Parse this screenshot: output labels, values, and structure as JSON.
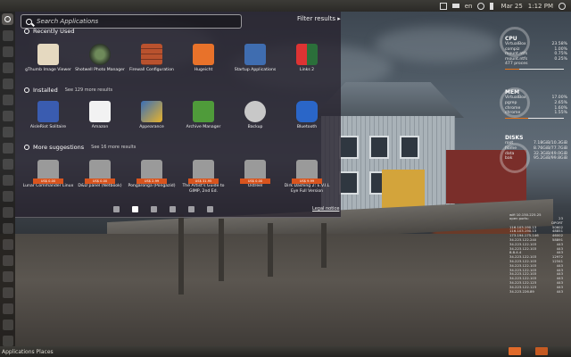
{
  "top_panel": {
    "keyboard": "en",
    "date": "Mar 25",
    "time": "1:12 PM"
  },
  "dash": {
    "search_placeholder": "Search Applications",
    "filter_label": "Filter results",
    "recent": {
      "title": "Recently Used",
      "apps": [
        {
          "label": "gThumb Image Viewer",
          "icon": "eye-icon",
          "color": "#e5d9c0"
        },
        {
          "label": "Shotwell Photo Manager",
          "icon": "camera-lens-icon",
          "color": "#3d4a3a"
        },
        {
          "label": "Firewall Configuration",
          "icon": "brick-wall-icon",
          "color": "#b9522e"
        },
        {
          "label": "Hugeicht",
          "icon": "share-icon",
          "color": "#e8722a"
        },
        {
          "label": "Startup Applications",
          "icon": "gear-icon",
          "color": "#3f6db0"
        },
        {
          "label": "Links 2",
          "icon": "links-icon",
          "color": "#2b6f3a"
        }
      ]
    },
    "installed": {
      "title": "Installed",
      "more": "See 129 more results",
      "apps": [
        {
          "label": "AisleRiot Solitaire",
          "icon": "cards-icon",
          "color": "#3a5cb0"
        },
        {
          "label": "Amazon",
          "icon": "amazon-icon",
          "color": "#f2f2f2"
        },
        {
          "label": "Appearance",
          "icon": "appearance-icon",
          "color": "#3a6fb8"
        },
        {
          "label": "Archive Manager",
          "icon": "archive-icon",
          "color": "#4f9b3a"
        },
        {
          "label": "Backup",
          "icon": "backup-icon",
          "color": "#c8c8c8"
        },
        {
          "label": "Bluetooth",
          "icon": "bluetooth-icon",
          "color": "#2a66c8"
        }
      ]
    },
    "suggestions": {
      "title": "More suggestions",
      "more": "See 16 more results",
      "apps": [
        {
          "label": "Lunar Commander Linux",
          "price": "US$ 0.00",
          "icon": "package-icon"
        },
        {
          "label": "D&D panel (Netbook)",
          "price": "US$ 0.00",
          "icon": "package-icon"
        },
        {
          "label": "Pongaronga (Pongazid)",
          "price": "US$ 2.99",
          "icon": "package-icon"
        },
        {
          "label": "The Artist's Guide to GIMP, 2nd Ed.",
          "price": "US$ 31.95",
          "icon": "package-icon"
        },
        {
          "label": "Ostreel",
          "price": "US$ 0.00",
          "icon": "package-icon"
        },
        {
          "label": "Dirk Dashing 2: E.V.I.L Eye Full Version",
          "price": "US$ 9.99",
          "icon": "package-icon"
        }
      ]
    },
    "legal": "Legal notice"
  },
  "conky": {
    "cpu": {
      "title": "CPU",
      "rows": [
        {
          "name": "VirtualBox",
          "val": "23.58%"
        },
        {
          "name": "compiz",
          "val": "1.00%"
        },
        {
          "name": "mount.ntfs",
          "val": "0.75%"
        },
        {
          "name": "mount.ntfs",
          "val": "0.25%"
        }
      ],
      "processes": "477 proces",
      "load": 0.24
    },
    "mem": {
      "title": "MEM",
      "rows": [
        {
          "name": "VirtualBox",
          "val": "17.00%"
        },
        {
          "name": "pgrep",
          "val": "2.65%"
        },
        {
          "name": "chrome",
          "val": "1.60%"
        },
        {
          "name": "chrome",
          "val": "1.55%"
        }
      ],
      "load": 0.4
    },
    "disks": {
      "title": "DISKS",
      "rows": [
        {
          "name": "root",
          "val": "7.18GiB/10.3GiB"
        },
        {
          "name": "home",
          "val": "8.76GiB/77.7GiB"
        },
        {
          "name": "data",
          "val": "32.3GiB/49.0GiB"
        },
        {
          "name": "bak",
          "val": "95.2GiB/99.8GiB"
        }
      ]
    },
    "net": {
      "wifi": "wifi 10.150.225.25",
      "ports_label": "open ports:",
      "ports_count": "23",
      "col_header": "DPORT",
      "rows": [
        {
          "ip": "116.103.190.13",
          "port": "50602"
        },
        {
          "ip": "116.103.190.13",
          "port": "48851"
        },
        {
          "ip": "173.194.175.146",
          "port": "46002"
        },
        {
          "ip": "34.223.122.240",
          "port": "58891"
        },
        {
          "ip": "34.223.122.103",
          "port": "443"
        },
        {
          "ip": "34.223.122.103",
          "port": "443"
        },
        {
          "ip": "8.8.4.4",
          "port": "443"
        },
        {
          "ip": "34.223.122.103",
          "port": "12972"
        },
        {
          "ip": "34.223.122.103",
          "port": "12341"
        },
        {
          "ip": "34.223.122.103",
          "port": "443"
        },
        {
          "ip": "34.223.122.103",
          "port": "443"
        },
        {
          "ip": "34.223.122.103",
          "port": "443"
        },
        {
          "ip": "34.223.122.103",
          "port": "443"
        },
        {
          "ip": "34.223.122.123",
          "port": "443"
        },
        {
          "ip": "34.223.122.123",
          "port": "443"
        },
        {
          "ip": "34.223.226.89",
          "port": "443"
        }
      ]
    }
  },
  "bottom_panel": {
    "label": "Applications Places"
  }
}
